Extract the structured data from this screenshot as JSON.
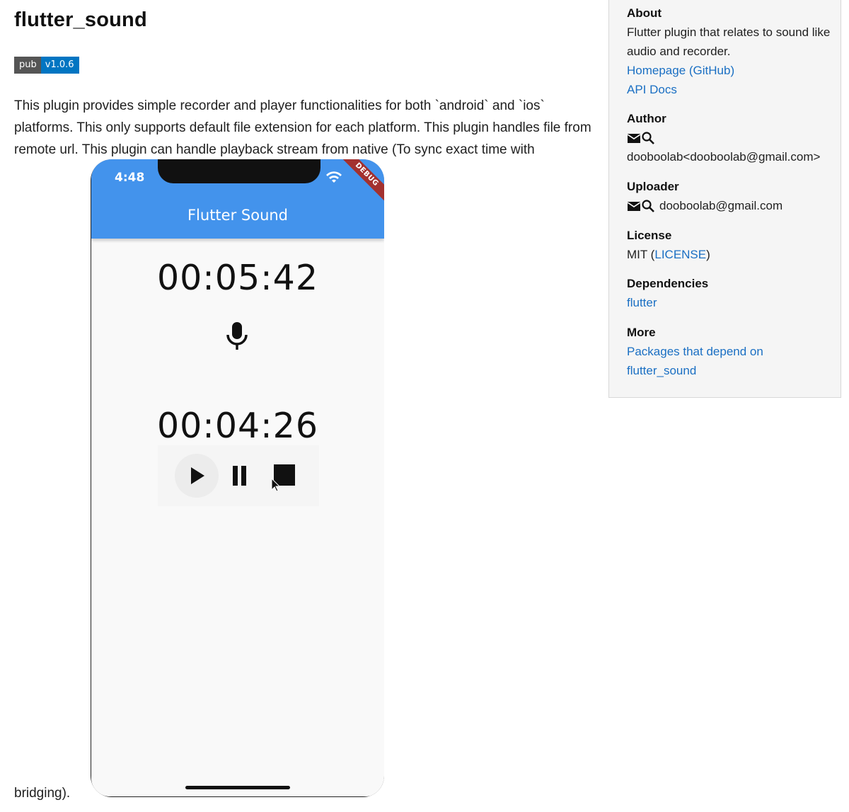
{
  "package": {
    "title": "flutter_sound",
    "badge_left": "pub",
    "badge_right": "v1.0.6",
    "description": "This plugin provides simple recorder and player functionalities for both `android` and `ios` platforms. This only supports default file extension for each platform. This plugin handles file from remote url. This plugin can handle playback stream from native (To sync exact time with",
    "description_tail": "bridging)."
  },
  "phone": {
    "status_time": "4:48",
    "debug_label": "DEBUG",
    "app_title": "Flutter Sound",
    "record_timer": "00:05:42",
    "play_timer": "00:04:26",
    "icons": {
      "mic": "mic-icon",
      "play": "play-icon",
      "pause": "pause-icon",
      "stop": "stop-icon",
      "wifi": "wifi-icon",
      "battery": "battery-icon"
    },
    "colors": {
      "appbar": "#4393ec",
      "debug_ribbon": "#a3312f"
    }
  },
  "sidebar": {
    "about": {
      "heading": "About",
      "text": "Flutter plugin that relates to sound like audio and recorder.",
      "links": [
        "Homepage (GitHub)",
        "API Docs"
      ]
    },
    "author": {
      "heading": "Author",
      "email_display": "dooboolab<dooboolab@gmail.com>"
    },
    "uploader": {
      "heading": "Uploader",
      "email": "dooboolab@gmail.com"
    },
    "license": {
      "heading": "License",
      "prefix": "MIT (",
      "link": "LICENSE",
      "suffix": ")"
    },
    "dependencies": {
      "heading": "Dependencies",
      "items": [
        "flutter"
      ]
    },
    "more": {
      "heading": "More",
      "link_line1": "Packages that depend on",
      "link_line2": "flutter_sound"
    }
  },
  "colors": {
    "link": "#1a6fc3",
    "badge_left": "#555555",
    "badge_right": "#0175c2",
    "sidebar_bg": "#f5f5f5"
  }
}
